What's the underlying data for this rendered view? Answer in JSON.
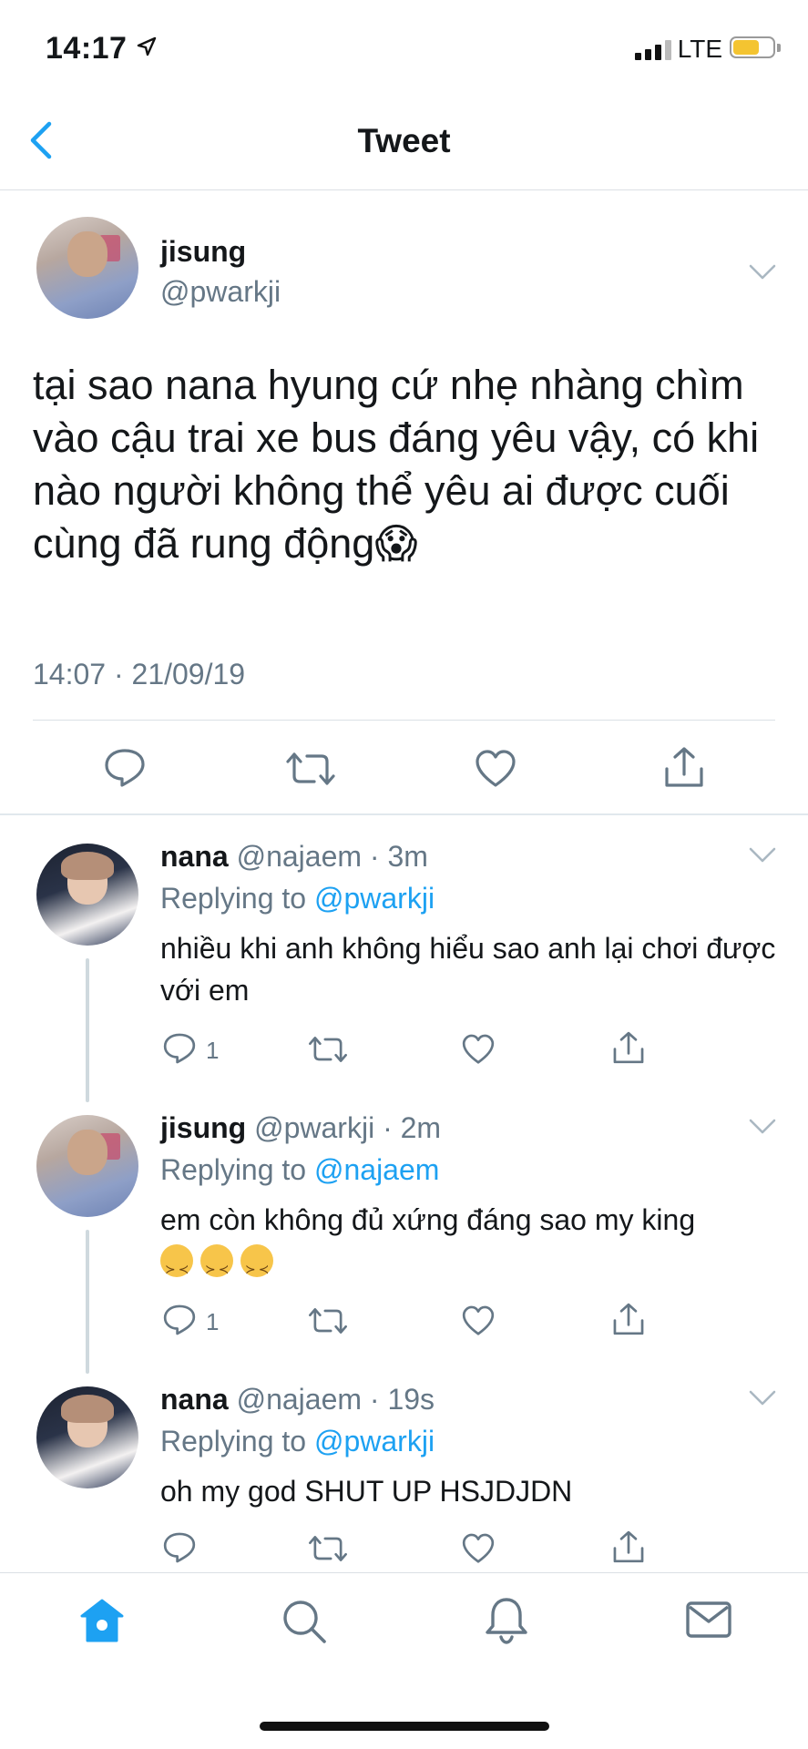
{
  "status_bar": {
    "time": "14:17",
    "carrier": "LTE",
    "battery_color": "#f4c431"
  },
  "nav": {
    "title": "Tweet"
  },
  "main_tweet": {
    "name": "jisung",
    "handle": "@pwarkji",
    "text": "tại sao nana hyung cứ nhẹ nhàng chìm vào cậu trai xe bus đáng yêu vậy, có khi nào người không thể yêu ai được cuối cùng đã rung động😱",
    "timestamp": "14:07 · 21/09/19"
  },
  "replies": [
    {
      "name": "nana",
      "meta": "@najaem · 3m",
      "replying_prefix": "Replying to",
      "replying_to": "@pwarkji",
      "text": "nhiều khi anh không hiểu sao anh lại chơi được với em",
      "reply_count": "1"
    },
    {
      "name": "jisung",
      "meta": "@pwarkji · 2m",
      "replying_prefix": "Replying to",
      "replying_to": "@najaem",
      "text": "em còn không đủ xứng đáng sao my king",
      "reply_count": "1"
    },
    {
      "name": "nana",
      "meta": "@najaem · 19s",
      "replying_prefix": "Replying to",
      "replying_to": "@pwarkji",
      "text": "oh my god SHUT UP HSJDJDN",
      "reply_count": ""
    }
  ],
  "colors": {
    "accent": "#1da1f2",
    "secondary_text": "#657786",
    "icon_gray": "#657786"
  },
  "tab_bar": [
    "home-icon",
    "search-icon",
    "bell-icon",
    "mail-icon"
  ]
}
